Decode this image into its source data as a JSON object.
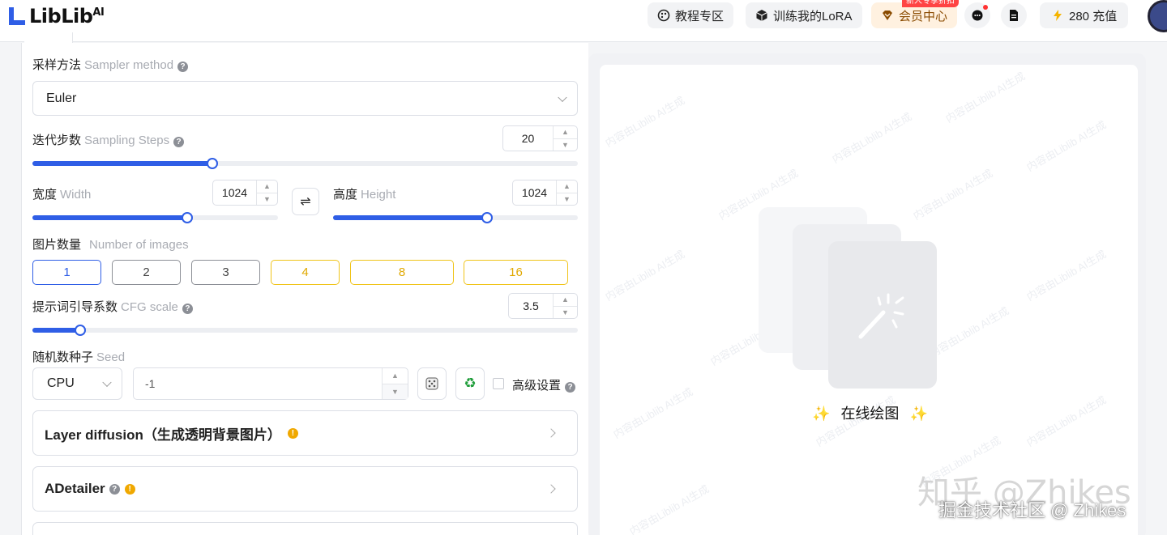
{
  "header": {
    "logo_text": "LibLib",
    "logo_suffix": "AI",
    "nav": {
      "tutorial": "教程专区",
      "train_lora": "训练我的LoRA",
      "vip": "会员中心",
      "vip_tag": "新人专享折扣",
      "recharge": "280 充值"
    }
  },
  "form": {
    "sampler": {
      "label": "采样方法",
      "label_en": "Sampler method",
      "value": "Euler"
    },
    "steps": {
      "label": "迭代步数",
      "label_en": "Sampling Steps",
      "value": "20",
      "fraction": 0.33
    },
    "width": {
      "label": "宽度",
      "label_en": "Width",
      "value": "1024",
      "fraction": 0.63
    },
    "height": {
      "label": "高度",
      "label_en": "Height",
      "value": "1024",
      "fraction": 0.63
    },
    "swap_icon": "⇌",
    "image_count": {
      "label": "图片数量",
      "label_en": "Number of images",
      "options": [
        "1",
        "2",
        "3",
        "4",
        "8",
        "16"
      ],
      "selected": "1"
    },
    "cfg": {
      "label": "提示词引导系数",
      "label_en": "CFG scale",
      "value": "3.5",
      "fraction": 0.087
    },
    "seed": {
      "label": "随机数种子",
      "label_en": "Seed",
      "device": "CPU",
      "value": "-1",
      "dice_icon": "dice-icon",
      "recycle_icon": "recycle-icon"
    },
    "advanced": {
      "label": "高级设置"
    }
  },
  "accordions": {
    "layer_diffusion": "Layer diffusion（生成透明背景图片）",
    "adetailer": "ADetailer"
  },
  "preview": {
    "caption": "在线绘图",
    "sparkle": "✨",
    "watermark": "内容由Liblib AI生成"
  },
  "overlay": {
    "zhihu": "知乎 @Zhikes",
    "juejin": "掘金技术社区 @ Zhikes"
  }
}
